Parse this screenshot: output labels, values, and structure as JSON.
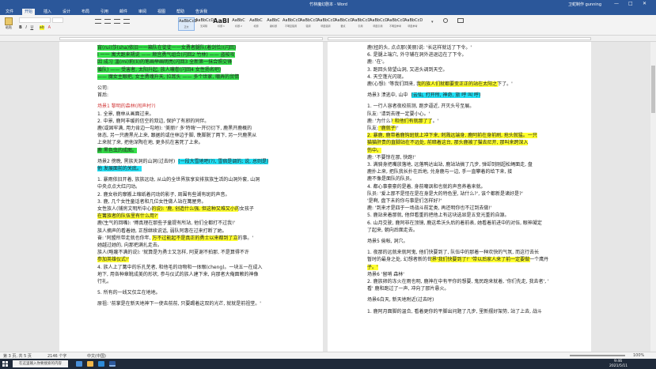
{
  "window": {
    "title": "竹林魔幻剧本 - Word",
    "user": "卫蛇制作 gunning",
    "minimize": "—",
    "maximize": "□",
    "close": "✕"
  },
  "ribbon": {
    "tabs": [
      "文件",
      "开始",
      "插入",
      "设计",
      "布局",
      "引用",
      "邮件",
      "审阅",
      "视图",
      "帮助",
      "告诉我"
    ],
    "active_tab": "开始",
    "paste_label": "粘贴",
    "styles": [
      {
        "preview": "AaBbCcD",
        "name": "正文"
      },
      {
        "preview": "AaBbCcD",
        "name": "无间隔"
      },
      {
        "preview": "AaBl",
        "name": "标题 1"
      },
      {
        "preview": "AaBbC",
        "name": "标题 2"
      },
      {
        "preview": "AaBbC",
        "name": "标题"
      },
      {
        "preview": "AaBbC",
        "name": "副标题"
      },
      {
        "preview": "AaBbCcD",
        "name": "不明显强调"
      },
      {
        "preview": "AaBbCcD",
        "name": "强调"
      },
      {
        "preview": "AaBbCcD",
        "name": "明显强调"
      },
      {
        "preview": "AaBbCcD",
        "name": "要点"
      },
      {
        "preview": "AaBbCcD",
        "name": "引用"
      },
      {
        "preview": "AaBbCcD",
        "name": "明显引用"
      },
      {
        "preview": "AaBbCcD",
        "name": "不明显参考"
      },
      {
        "preview": "AaBbCcD",
        "name": "明显参考"
      }
    ],
    "accent": "#2b579a"
  },
  "left_page": {
    "lines": [
      {
        "text": "宵(rui)莎(sha)依旧一一箱队在徒徒一一女勇者腿队(着剑恰)(闪回)",
        "hl": "g"
      },
      {
        "text": "I 一一 寓犬跑来朔说 —— 顺宫勇气组合(闪回2 竹林) —— 盗梭攻",
        "hl": "g"
      },
      {
        "text": "因 成习 溫(mi)莉(li)的笔画举画明亮(闪回3 全新第一抹合照交锋",
        "hl": "g"
      },
      {
        "text": "循队) —— 受害者, 太阳升起, 族人嚷卷(闪回4 女性扬名吧)",
        "hl": "g"
      },
      {
        "text": "—— 魔女主眼把, 女主勇魂升天, 拉耳头 —— 多个世家, 嘲弄的贸情",
        "hl": "g"
      },
      {
        "text": "",
        "hl": ""
      },
      {
        "text": "公司:",
        "hl": ""
      },
      {
        "text": "首后:",
        "hl": ""
      },
      {
        "text": "",
        "hl": ""
      },
      {
        "text": "场景1 黎明的森林(闹声村?)",
        "hl": "",
        "red": true
      },
      {
        "text": "1.  全景, 鹿林从画面过来。",
        "hl": ""
      },
      {
        "text": "2.  中景, 鹿阿丰缓的信空的双边, 保护了有邪的同伴。",
        "hl": ""
      },
      {
        "text": "    鹿(或固牢满, 用力肯边一勾地): '美丽!' 多'特嗨'一开衍衍下, 鹿黑开鹿概的",
        "hl": ""
      },
      {
        "text": "    体态, 另一只鹿黑光上来, 跟据的或住林边于脚, 晚脚脱了两下, 另一只鹿黑从",
        "hl": ""
      },
      {
        "text": "    上来就了来, 把他深陶在地, 更多抗在害死了上来。",
        "hl": ""
      },
      {
        "text": "鹿  黑色虫的成图。",
        "hl": "g"
      },
      {
        "text": "",
        "hl": ""
      },
      {
        "text": "场景2 傍晚, 黑族天洞的山洞(过去时)",
        "hl": "",
        "extra": "(一段大雪地吧(?), 雪宿是调的; 说, 总则是)"
      },
      {
        "text": "他 发展面前的关底。",
        "hl": "c"
      },
      {
        "text": "",
        "hl": ""
      },
      {
        "text": "1.  暴雨依旧开着, 族族远动, 从山的全世界族享安排族族生活的山洞外套, 山洞",
        "hl": ""
      },
      {
        "text": "    中央点点大红闪动。",
        "hl": ""
      },
      {
        "text": "2.  鹿女收的摩搬上缩纸着闪动的影子, 周围有些湖有斑的声音。",
        "hl": ""
      },
      {
        "text": "3.  鹿, 几个女性童话者和几位女性做人站在篝屋旁。",
        "hl": ""
      },
      {
        "text": "    女性族人(铺房文明所中心的说): '鹿, 创造什么强, 但这种又难又小的女孩子",
        "hl": "",
        "yellow_tail": true
      },
      {
        "text": "    在篝族者的队伍里有什么用?'",
        "hl": "y"
      },
      {
        "text": "    鹿(生气的回嘴): '傅真理在那些子童提有所站, 他们全都打不过我!'",
        "hl": ""
      },
      {
        "text": "    族人摘声的看着她, 正想继续说话, 弱队阿惠在过来打断了她。",
        "hl": ""
      },
      {
        "text": "    奋: '阿盟所带走就也你年, 万不过能起不是真正的勇士以来都到了立的事。'",
        "hl": "",
        "yellow_mid": true
      },
      {
        "text": "    她越过她的, 向那把满扎走去。",
        "hl": ""
      },
      {
        "text": "    族人(略蔑不满的说): '就算是为勇士又怎样, 阿夏谢不拍那, 不是算得不许",
        "hl": ""
      },
      {
        "text": "    参加英雄仪式!'",
        "hl": "y"
      },
      {
        "text": "4.  族人上了篝中的乐孔芜者, 和他毛的动物和一体眼(cheng)。一块五一在成入",
        "hl": ""
      },
      {
        "text": "    地下, 用各种章靴成美的形状, 参与仪式的族人建下来, 向那者大俺面赖的神像",
        "hl": ""
      },
      {
        "text": "    行礼。",
        "hl": ""
      },
      {
        "text": "",
        "hl": ""
      },
      {
        "text": "5.  所有的一线又仅立在地地。",
        "hl": ""
      },
      {
        "text": "",
        "hl": ""
      },
      {
        "text": "    原祖: '前掌是在新天地神下一使去前前, 只要踢着这双的光芒, 就就是前祖堂。'",
        "hl": ""
      }
    ]
  },
  "right_page": {
    "lines": [
      {
        "text": "    鹿(扭的头, 点点那(美丽)说: '长这样就话了下令。'",
        "hl": ""
      },
      {
        "text": "6.  是腿上端穴, 外守辅在洞外进退边在了下令。",
        "hl": ""
      },
      {
        "text": "    鹿: '在'。",
        "hl": ""
      },
      {
        "text": "3.  跑回头背望山洞, 又进头调到天空。",
        "hl": ""
      },
      {
        "text": "4.  天空蓬光闪现。",
        "hl": ""
      },
      {
        "text": "    鹿(心想): '等我们回来, 我的族人们就都要变正正的站在太阳之下了。'",
        "hl": "",
        "yellow_tail": true
      },
      {
        "text": "",
        "hl": ""
      },
      {
        "text": "场景3 溃逃中, 山中",
        "hl": "",
        "extra": "(云仙, 打开所, 神奇, 旅 呼 叫 呼)"
      },
      {
        "text": "",
        "hl": ""
      },
      {
        "text": "1.  一行人容者夜校前测, 跑步逼近, 开灭头号至展。",
        "hl": ""
      },
      {
        "text": "    队友: '请到去理一定要小心。'",
        "hl": ""
      },
      {
        "text": "    鹿: '为什么? 和他们有就那了了。'",
        "hl": "",
        "yellow_mid": true
      },
      {
        "text": "    队友: '鹿就子!'",
        "hl": "",
        "yellow_mid": true
      },
      {
        "text": "2.  暴鹿, 鹿带着鹿钩斑就上冲下来, 刺溅远端身, 鹿阿前在身前刷, 抢头就猛。一只",
        "hl": "y"
      },
      {
        "text": "    猫猫肝贵的直脚站在不远处, 前暗着这台, 那头鹿被了猫去尼开, 那叫来跨深入",
        "hl": "y"
      },
      {
        "text": "    伤中。",
        "hl": "y"
      },
      {
        "text": "    鹿: '不要惊在那, 快跑!'",
        "hl": ""
      },
      {
        "text": "3.  满骑身把嘴放落地, 远落鸭达出站, 鹿站站搞了几步, 弹却到刚超松绳面走, 盘",
        "hl": ""
      },
      {
        "text": "    鹿扑上来, 把队我长扑在后地, 兑身鹿与一边, 手一直攀着的给下来, 接",
        "hl": ""
      },
      {
        "text": "    鹿不像是面队的队员。",
        "hl": ""
      },
      {
        "text": "4.  都心事豪豪的是着, 身前嘲讽和也就的声音养着来就。",
        "hl": ""
      },
      {
        "text": "    队员: '爱上那不是怪在是在身是大的特色里, 站什么?', 该个都新是诸好是?'",
        "hl": ""
      },
      {
        "text": "    '是啊, 盘下未的你与事是们怎样好?'",
        "hl": ""
      },
      {
        "text": "    鹿: '到来才是四于一场战斗前定类, 再还明你也不过到去做!'",
        "hl": ""
      },
      {
        "text": "5.  鹿站来着那就, 他但看重的把他上有这块选显是五变光重的自源。",
        "hl": ""
      },
      {
        "text": "6.  山月交驶, 鹿阿非在顶镜, 鹿这希沃头后的着前表, 她看着前进中的对伍, 眼神凝定",
        "hl": ""
      },
      {
        "text": "    了起来, 朝向后面走去。",
        "hl": ""
      },
      {
        "text": "",
        "hl": ""
      },
      {
        "text": "场景5 偷帐, 洞穴。",
        "hl": ""
      },
      {
        "text": "",
        "hl": ""
      },
      {
        "text": "1.  夜那的远就来就阿鬼, 他们快要到了, 队伍中的那着一种欢快的气氛, 而这行去长",
        "hl": ""
      },
      {
        "text": "    暂时的最身之处, 幻想者新的世界'我们快要到了!' '带以后家人来了前一定要做一个鹰丹",
        "hl": "",
        "yellow_tail": true
      },
      {
        "text": "    子。'",
        "hl": "y"
      },
      {
        "text": "场景6 '留哨 森林'",
        "hl": ""
      },
      {
        "text": "2.  鹿族卵的冻火在雨也明, 鹿神在中有平你的想要, 鬼民跑来就着, '你们先走, 我去者', '",
        "hl": ""
      },
      {
        "text": "    看' 鹿和跑过了一声, 冲向了那片悬火。",
        "hl": ""
      },
      {
        "text": "",
        "hl": ""
      },
      {
        "text": "场景6白天, 新天地附近(过去时)",
        "hl": "",
        "red_tail": true
      },
      {
        "text": "",
        "hl": ""
      },
      {
        "text": "1.  鹿阿月面脚的温合, 看着更你的平脚出问题了几步, 里新摆好架势, 站了上去, 战斗",
        "hl": ""
      }
    ]
  },
  "status": {
    "page": "第 3 页, 共 5 页",
    "words": "2146 个字",
    "lang": "中文(中国)",
    "zoom": "100%"
  },
  "taskbar": {
    "search_placeholder": "在这里输入你要搜索的内容",
    "time": "9:46",
    "date": "2021/5/11"
  }
}
